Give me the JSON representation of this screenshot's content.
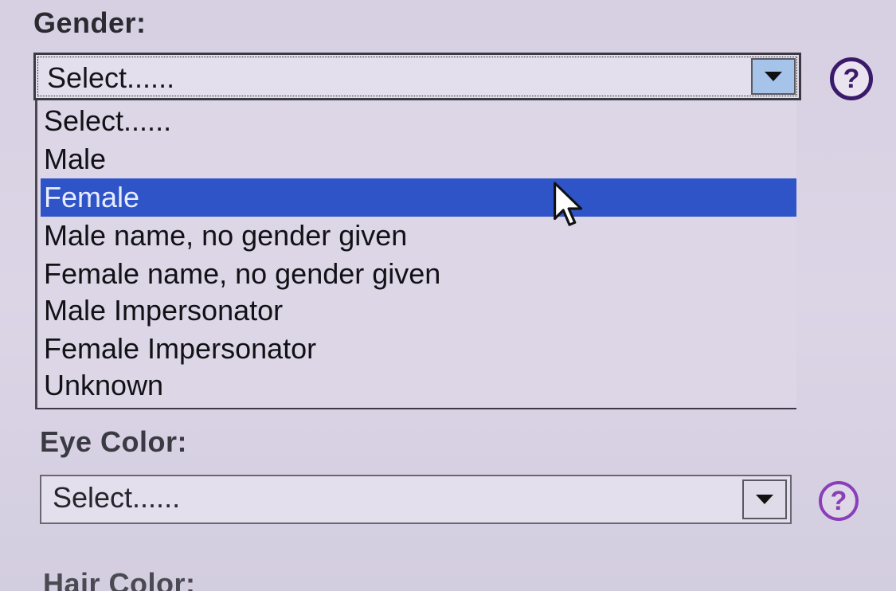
{
  "gender": {
    "label": "Gender:",
    "selected_value": "Select......",
    "options": [
      "Select......",
      "Male",
      "Female",
      "Male name, no gender given",
      "Female name, no gender given",
      "Male Impersonator",
      "Female Impersonator",
      "Unknown"
    ],
    "highlighted_option": "Female",
    "help_icon": "?"
  },
  "eye_color": {
    "label": "Eye Color:",
    "selected_value": "Select......",
    "help_icon": "?"
  },
  "hair_color": {
    "label": "Hair Color:"
  },
  "colors": {
    "highlight": "#2e54c8",
    "help_icon_dark": "#3a1a6a",
    "help_icon_light": "#8a3fb8",
    "arrow_button_active": "#a6c3ea",
    "background": "#d9d3e4"
  },
  "icons": {
    "help": "question-circle-icon",
    "dropdown": "chevron-down-icon",
    "cursor": "mouse-pointer-icon"
  }
}
